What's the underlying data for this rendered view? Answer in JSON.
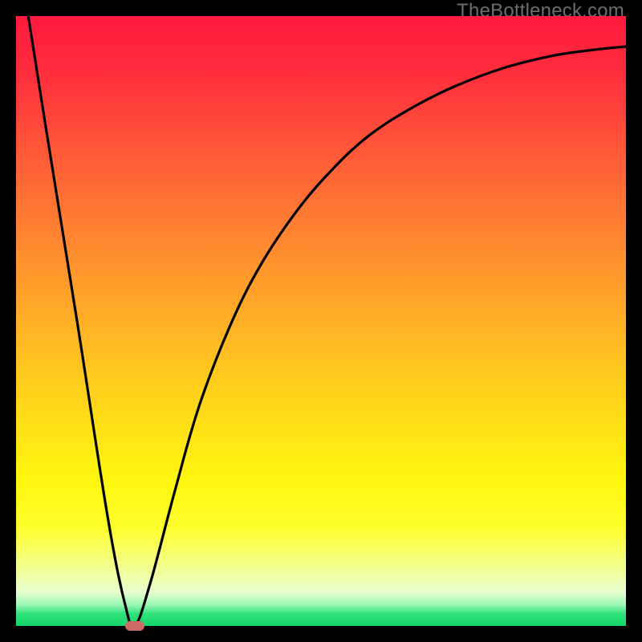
{
  "attribution": "TheBottleneck.com",
  "colors": {
    "frame": "#000000",
    "gradient_top": "#ff1a3f",
    "gradient_bottom": "#14d66a",
    "curve": "#000000",
    "marker": "#cc6b66",
    "attribution_text": "#6d6d6d"
  },
  "chart_data": {
    "type": "line",
    "title": "",
    "xlabel": "",
    "ylabel": "",
    "x_range": [
      0,
      100
    ],
    "y_range": [
      0,
      100
    ],
    "grid": false,
    "series": [
      {
        "name": "bottleneck-curve",
        "x": [
          2,
          5,
          10,
          15,
          18,
          19.5,
          22,
          26,
          30,
          35,
          40,
          46,
          52,
          58,
          65,
          72,
          80,
          88,
          95,
          100
        ],
        "y": [
          100,
          81,
          50,
          18,
          3,
          0,
          7,
          22,
          36,
          49,
          59,
          68,
          75,
          80.5,
          85,
          88.5,
          91.5,
          93.5,
          94.5,
          95
        ]
      }
    ],
    "marker": {
      "x": 19.5,
      "y": 0
    },
    "notes": "y is mismatch percentage (0 at green bottom, 100 at red top); x is normalized horizontal position.",
    "background_gradient": {
      "direction": "vertical",
      "stops": [
        {
          "pos": 0.0,
          "color": "#ff1a3f"
        },
        {
          "pos": 0.28,
          "color": "#ff6b35"
        },
        {
          "pos": 0.58,
          "color": "#ffc71f"
        },
        {
          "pos": 0.84,
          "color": "#fdff2d"
        },
        {
          "pos": 0.96,
          "color": "#9df7b6"
        },
        {
          "pos": 1.0,
          "color": "#14d66a"
        }
      ]
    }
  }
}
